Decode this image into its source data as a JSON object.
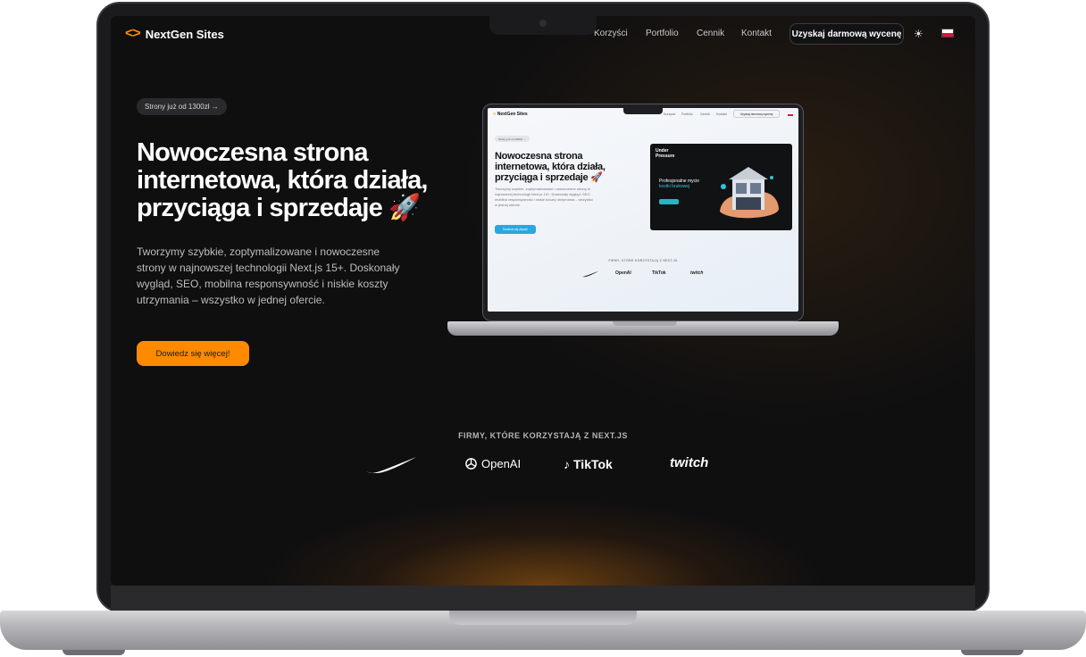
{
  "nav": {
    "logo_icon": "<>",
    "logo_text": "NextGen Sites",
    "links": [
      "Korzyści",
      "Portfolio",
      "Cennik",
      "Kontakt"
    ],
    "cta": "Uzyskaj darmową wycenę",
    "theme_icon": "sun-icon",
    "language": "pl"
  },
  "hero": {
    "badge": "Strony już od 1300zł →",
    "title_line1": "Nowoczesna strona",
    "title_line2": "internetowa, która działa,",
    "title_line3": "przyciąga i sprzedaje 🚀",
    "description": "Tworzymy szybkie, zoptymalizowane i nowoczesne strony w najnowszej technologii Next.js 15+. Doskonały wygląd, SEO, mobilna responsywność i niskie koszty utrzymania – wszystko w jednej ofercie.",
    "button": "Dowiedz się więcej!"
  },
  "companies": {
    "label": "FIRMY, KTÓRE KORZYSTAJĄ Z NEXT.JS",
    "brands": [
      "Nike",
      "OpenAI",
      "TikTok",
      "twitch"
    ]
  },
  "mockup": {
    "logo_text": "NextGen Sites",
    "links": [
      "Korzyści",
      "Portfolio",
      "Cennik",
      "Kontakt"
    ],
    "cta": "Uzyskaj darmową wycenę",
    "badge": "Strony już od 1300zł →",
    "title": "Nowoczesna strona internetowa, która działa, przyciąga i sprzedaje 🚀",
    "description": "Tworzymy szybkie, zoptymalizowane i nowoczesne strony w najnowszej technologii Next.js 15+. Doskonały wygląd, SEO, mobilna responsywność i niskie koszty utrzymania – wszystko w jednej ofercie.",
    "button": "Dowiedz się więcej!",
    "card_logo_1": "Under",
    "card_logo_2": "Pressure",
    "card_title": "Profesjonalne mycie",
    "card_accent": "kostki brukowej",
    "companies_label": "FIRMY, KTÓRE KORZYSTAJĄ Z NEXT.JS",
    "brands": [
      "OpenAI",
      "TikTok",
      "twitch"
    ]
  },
  "colors": {
    "accent": "#ff8a00",
    "background": "#0f0f10",
    "text": "#ffffff"
  }
}
